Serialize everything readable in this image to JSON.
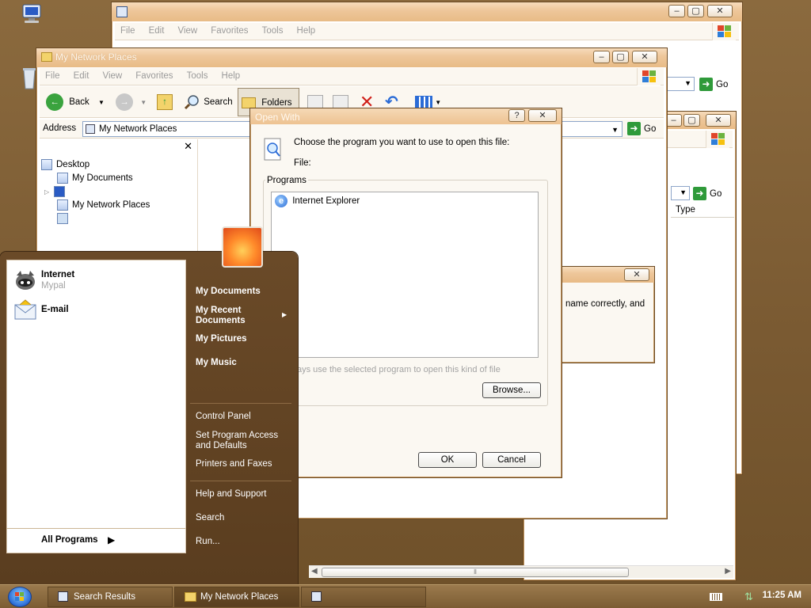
{
  "colors": {
    "accent": "#e8bb86",
    "start_menu_bg": "#5a3d1f",
    "taskbar": "#7b5c33",
    "ie_blue": "#2a6bd6"
  },
  "desktop": {
    "icons": [
      "computer-icon",
      "recycle-bin-icon"
    ]
  },
  "back_window": {
    "menus": [
      "File",
      "Edit",
      "View",
      "Favorites",
      "Tools",
      "Help"
    ],
    "go_label": "Go"
  },
  "right_window": {
    "go_label": "Go",
    "column_type": "Type"
  },
  "network_window": {
    "title": "My Network Places",
    "menus": [
      "File",
      "Edit",
      "View",
      "Favorites",
      "Tools",
      "Help"
    ],
    "toolbar": {
      "back": "Back",
      "search": "Search",
      "folders": "Folders"
    },
    "address_label": "Address",
    "address_value": "My Network Places",
    "go_label": "Go",
    "tree": {
      "desktop": "Desktop",
      "my_documents": "My Documents",
      "network_places": "My Network Places"
    }
  },
  "error_dialog": {
    "text": "name correctly, and"
  },
  "open_with": {
    "title": "Open With",
    "help_glyph": "?",
    "instruction": "Choose the program you want to use to open this file:",
    "file_label": "File:",
    "programs_label": "Programs",
    "programs": [
      "Internet Explorer"
    ],
    "always_use": "ays use the selected program to open this kind of file",
    "browse": "Browse...",
    "ok": "OK",
    "cancel": "Cancel"
  },
  "start_menu": {
    "pinned": [
      {
        "name": "Internet",
        "sub": "Mypal"
      },
      {
        "name": "E-mail",
        "sub": ""
      }
    ],
    "all_programs": "All Programs",
    "right_items": {
      "my_documents": "My Documents",
      "my_recent": "My Recent Documents",
      "my_pictures": "My Pictures",
      "my_music": "My Music",
      "control_panel": "Control Panel",
      "set_program_access": "Set Program Access and Defaults",
      "printers": "Printers and Faxes",
      "help": "Help and Support",
      "search": "Search",
      "run": "Run..."
    }
  },
  "taskbar": {
    "buttons": [
      "Search Results",
      "My Network Places",
      ""
    ],
    "clock": "11:25 AM"
  }
}
